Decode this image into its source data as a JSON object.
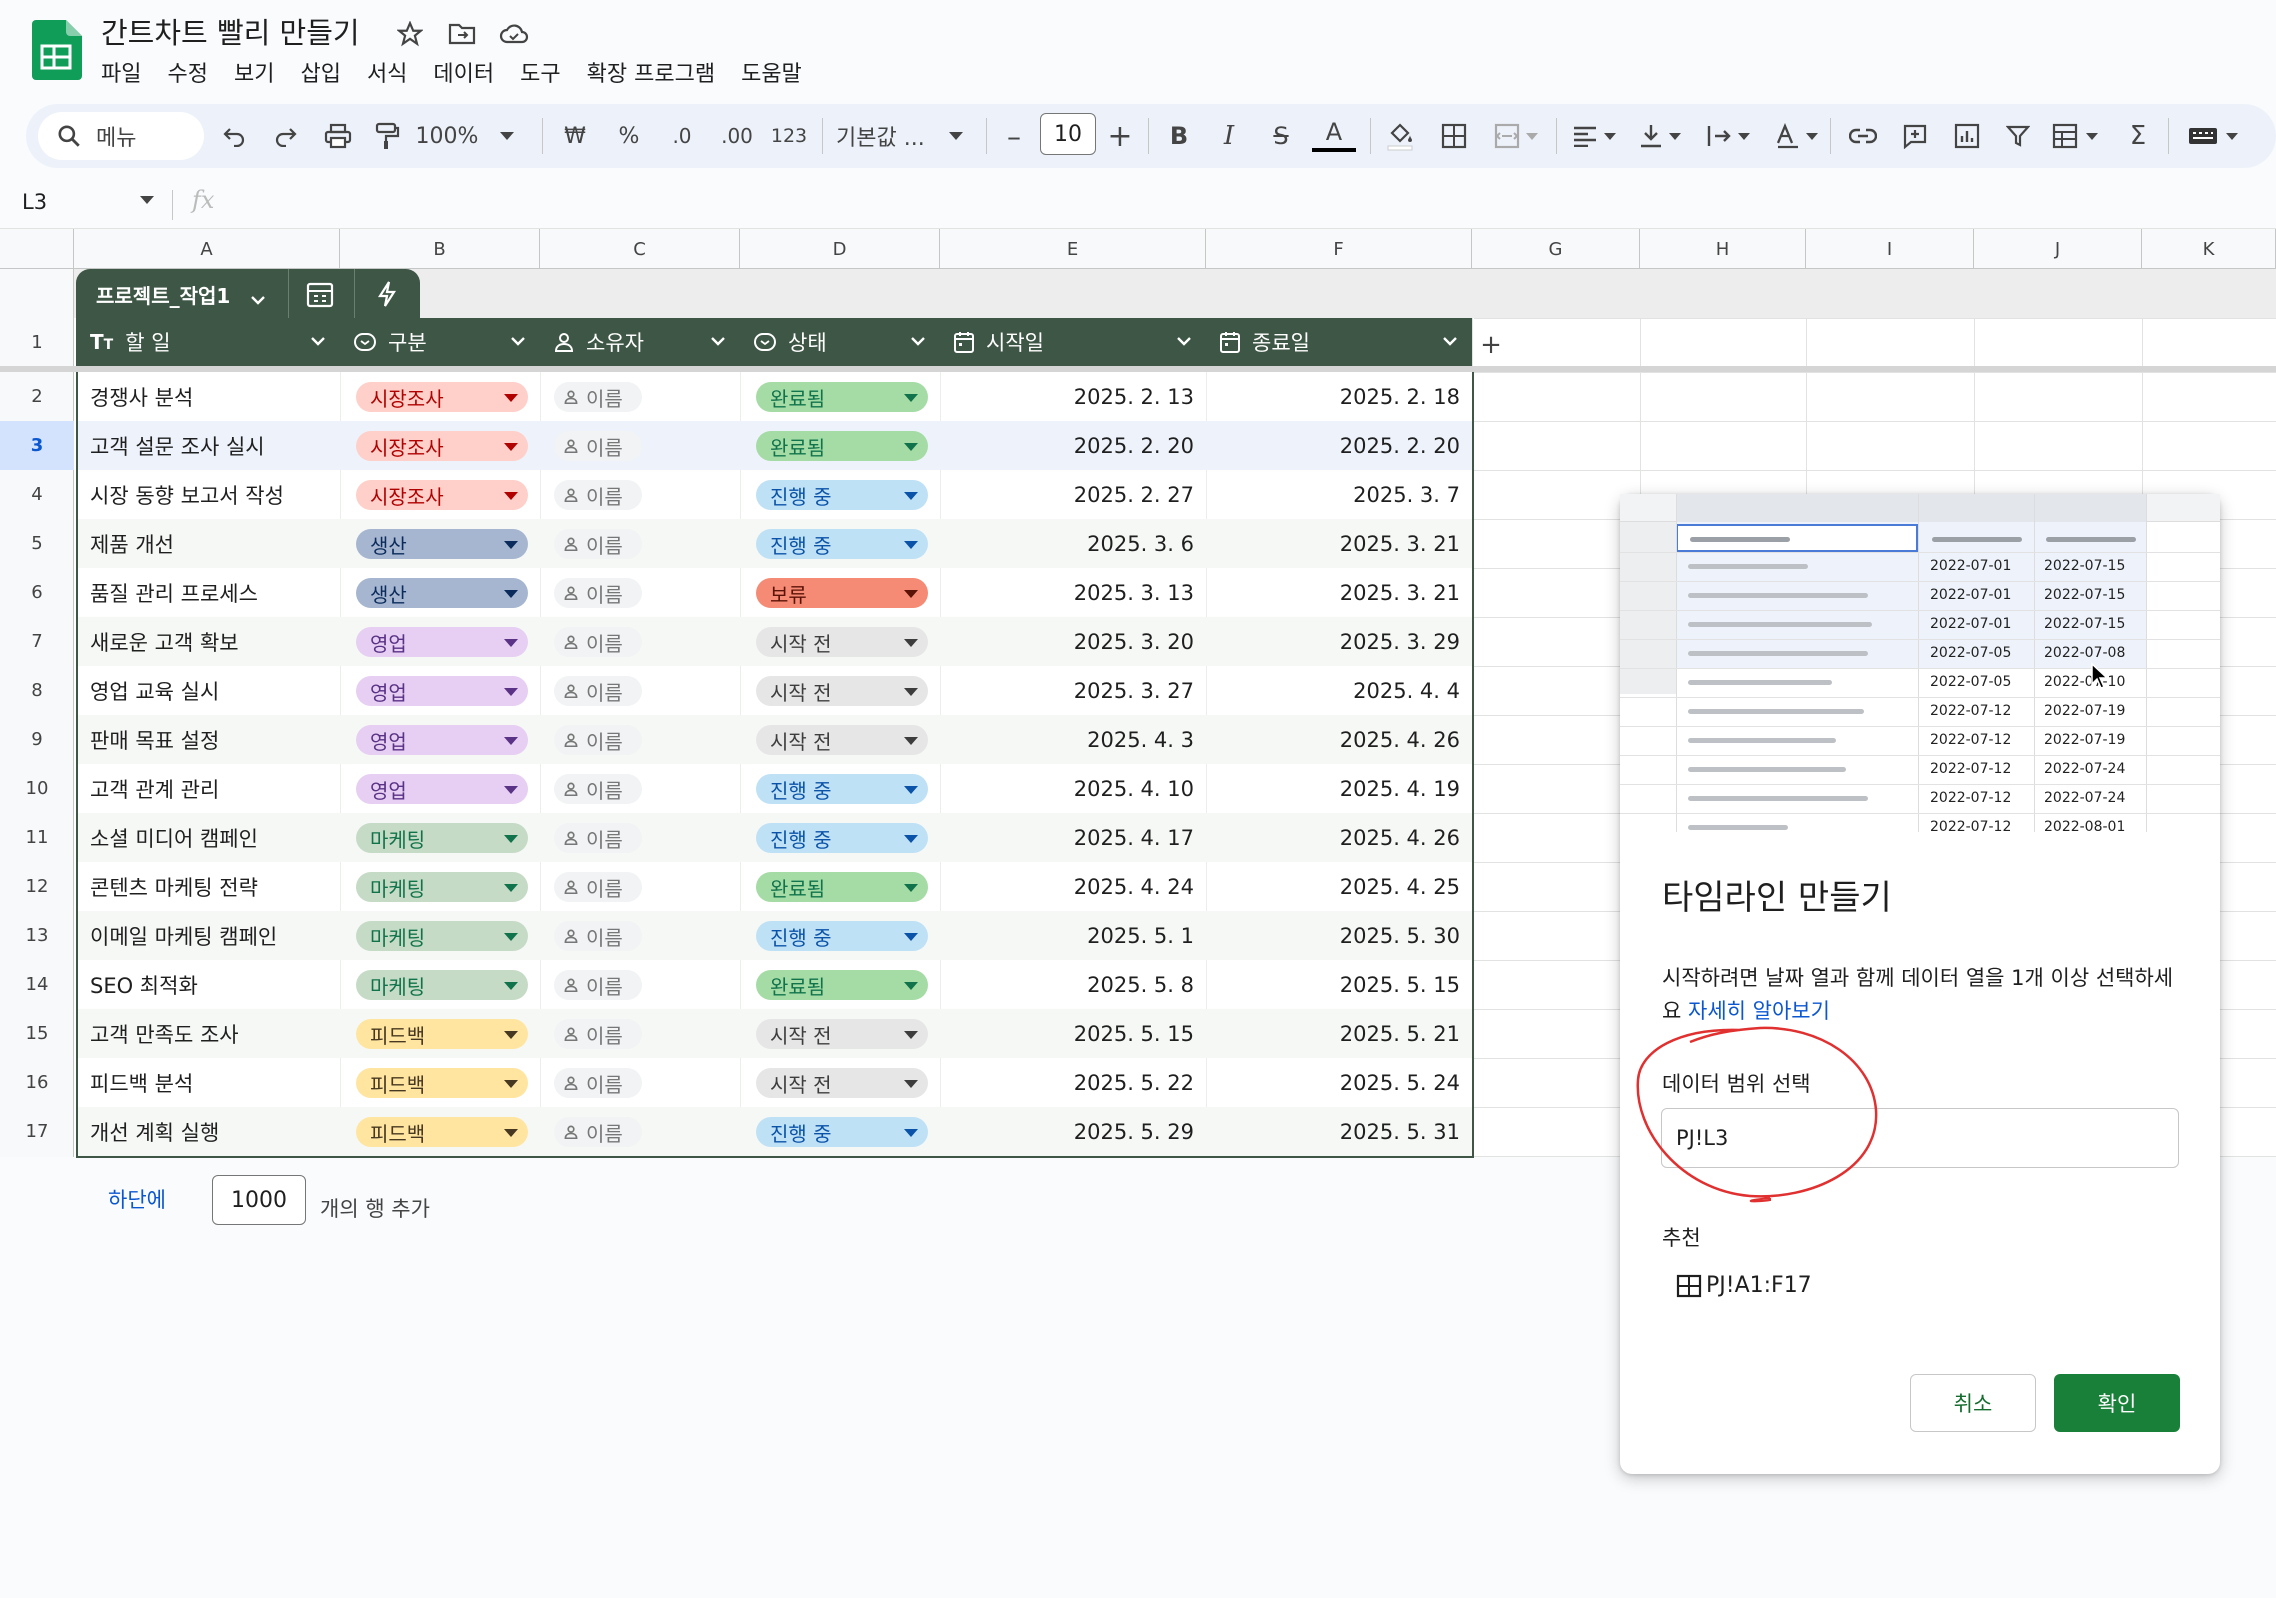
{
  "app": {
    "title": "간트차트 빨리 만들기",
    "menu": [
      "파일",
      "수정",
      "보기",
      "삽입",
      "서식",
      "데이터",
      "도구",
      "확장 프로그램",
      "도움말"
    ]
  },
  "toolbar": {
    "search_placeholder": "메뉴",
    "zoom": "100%",
    "currency": "₩",
    "percent": "%",
    "dec_decrease": ".0",
    "dec_increase": ".00",
    "number_format": "123",
    "font": "기본값 ...",
    "font_size": "10",
    "bold": "B",
    "italic": "I",
    "strike": "S",
    "text_color": "A"
  },
  "formula_bar": {
    "name_box": "L3",
    "fx": "fx"
  },
  "columns": [
    "A",
    "B",
    "C",
    "D",
    "E",
    "F",
    "G",
    "H",
    "I",
    "J",
    "K"
  ],
  "row_numbers": [
    "1",
    "2",
    "3",
    "4",
    "5",
    "6",
    "7",
    "8",
    "9",
    "10",
    "11",
    "12",
    "13",
    "14",
    "15",
    "16",
    "17"
  ],
  "table": {
    "name": "프로젝트_작업1",
    "headers": [
      "할 일",
      "구분",
      "소유자",
      "상태",
      "시작일",
      "종료일"
    ],
    "rows": [
      {
        "task": "경쟁사 분석",
        "category": "시장조사",
        "owner": "이름",
        "status": "완료됨",
        "start": "2025. 2. 13",
        "end": "2025. 2. 18"
      },
      {
        "task": "고객 설문 조사 실시",
        "category": "시장조사",
        "owner": "이름",
        "status": "완료됨",
        "start": "2025. 2. 20",
        "end": "2025. 2. 20"
      },
      {
        "task": "시장 동향 보고서 작성",
        "category": "시장조사",
        "owner": "이름",
        "status": "진행 중",
        "start": "2025. 2. 27",
        "end": "2025. 3. 7"
      },
      {
        "task": "제품 개선",
        "category": "생산",
        "owner": "이름",
        "status": "진행 중",
        "start": "2025. 3. 6",
        "end": "2025. 3. 21"
      },
      {
        "task": "품질 관리 프로세스",
        "category": "생산",
        "owner": "이름",
        "status": "보류",
        "start": "2025. 3. 13",
        "end": "2025. 3. 21"
      },
      {
        "task": "새로운 고객 확보",
        "category": "영업",
        "owner": "이름",
        "status": "시작 전",
        "start": "2025. 3. 20",
        "end": "2025. 3. 29"
      },
      {
        "task": "영업 교육 실시",
        "category": "영업",
        "owner": "이름",
        "status": "시작 전",
        "start": "2025. 3. 27",
        "end": "2025. 4. 4"
      },
      {
        "task": "판매 목표 설정",
        "category": "영업",
        "owner": "이름",
        "status": "시작 전",
        "start": "2025. 4. 3",
        "end": "2025. 4. 26"
      },
      {
        "task": "고객 관계 관리",
        "category": "영업",
        "owner": "이름",
        "status": "진행 중",
        "start": "2025. 4. 10",
        "end": "2025. 4. 19"
      },
      {
        "task": "소셜 미디어 캠페인",
        "category": "마케팅",
        "owner": "이름",
        "status": "진행 중",
        "start": "2025. 4. 17",
        "end": "2025. 4. 26"
      },
      {
        "task": "콘텐츠 마케팅 전략",
        "category": "마케팅",
        "owner": "이름",
        "status": "완료됨",
        "start": "2025. 4. 24",
        "end": "2025. 4. 25"
      },
      {
        "task": "이메일 마케팅 캠페인",
        "category": "마케팅",
        "owner": "이름",
        "status": "진행 중",
        "start": "2025. 5. 1",
        "end": "2025. 5. 30"
      },
      {
        "task": "SEO 최적화",
        "category": "마케팅",
        "owner": "이름",
        "status": "완료됨",
        "start": "2025. 5. 8",
        "end": "2025. 5. 15"
      },
      {
        "task": "고객 만족도 조사",
        "category": "피드백",
        "owner": "이름",
        "status": "시작 전",
        "start": "2025. 5. 15",
        "end": "2025. 5. 21"
      },
      {
        "task": "피드백 분석",
        "category": "피드백",
        "owner": "이름",
        "status": "시작 전",
        "start": "2025. 5. 22",
        "end": "2025. 5. 24"
      },
      {
        "task": "개선 계획 실행",
        "category": "피드백",
        "owner": "이름",
        "status": "진행 중",
        "start": "2025. 5. 29",
        "end": "2025. 5. 31"
      }
    ]
  },
  "category_colors": {
    "시장조사": {
      "bg": "#ffcfc9",
      "fg": "#b10202"
    },
    "생산": {
      "bg": "#a6b6d0",
      "fg": "#0a2b5b"
    },
    "영업": {
      "bg": "#e6cff2",
      "fg": "#5a3286"
    },
    "마케팅": {
      "bg": "#c6dbc6",
      "fg": "#11734b"
    },
    "피드백": {
      "bg": "#ffe5a0",
      "fg": "#473821"
    }
  },
  "status_colors": {
    "완료됨": {
      "bg": "#a5dca5",
      "fg": "#11734b"
    },
    "진행 중": {
      "bg": "#bfe1f6",
      "fg": "#0a53a8"
    },
    "보류": {
      "bg": "#f58a75",
      "fg": "#5a1306"
    },
    "시작 전": {
      "bg": "#e6e6e6",
      "fg": "#3d3d3d"
    }
  },
  "add_rows": {
    "link": "하단에",
    "count": "1000",
    "suffix": "개의 행 추가"
  },
  "dialog": {
    "preview_dates": [
      [
        "2022-07-01",
        "2022-07-15"
      ],
      [
        "2022-07-01",
        "2022-07-15"
      ],
      [
        "2022-07-01",
        "2022-07-15"
      ],
      [
        "2022-07-05",
        "2022-07-08"
      ],
      [
        "2022-07-05",
        "2022-07-10"
      ],
      [
        "2022-07-12",
        "2022-07-19"
      ],
      [
        "2022-07-12",
        "2022-07-19"
      ],
      [
        "2022-07-12",
        "2022-07-24"
      ],
      [
        "2022-07-12",
        "2022-07-24"
      ],
      [
        "2022-07-12",
        "2022-08-01"
      ]
    ],
    "title": "타임라인 만들기",
    "description": "시작하려면 날짜 열과 함께 데이터 열을 1개 이상 선택하세요",
    "learn_more": "자세히 알아보기",
    "range_label": "데이터 범위 선택",
    "range_value": "PJ!L3",
    "suggest_label": "추천",
    "suggest_value": "PJ!A1:F17",
    "cancel": "취소",
    "ok": "확인"
  },
  "accent": {
    "sheets_green": "#188038",
    "table_header": "#3e5645",
    "annotation": "#e03030"
  }
}
